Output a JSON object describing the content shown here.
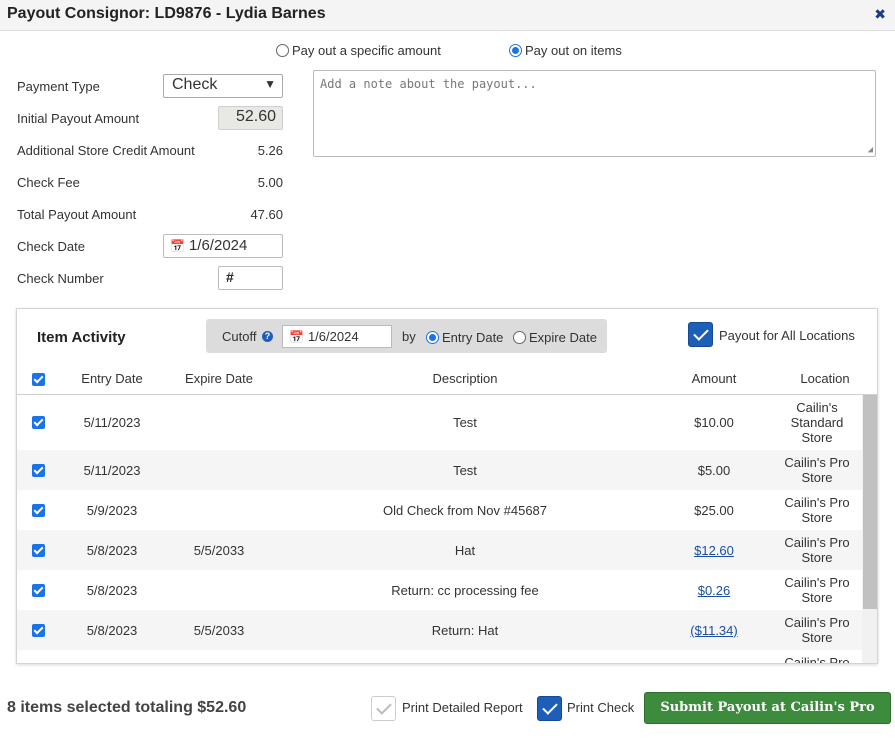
{
  "dialog": {
    "title": "Payout Consignor: LD9876 - Lydia Barnes"
  },
  "payout_mode": {
    "option_amount": "Pay out a specific amount",
    "option_items": "Pay out on items",
    "selected": "Pay out on items"
  },
  "form": {
    "payment_type_label": "Payment Type",
    "payment_type_value": "Check",
    "initial_label": "Initial Payout Amount",
    "initial_value": "52.60",
    "credit_label": "Additional Store Credit Amount",
    "credit_value": "5.26",
    "fee_label": "Check Fee",
    "fee_value": "5.00",
    "total_label": "Total Payout Amount",
    "total_value": "47.60",
    "date_label": "Check Date",
    "date_value": "1/6/2024",
    "number_label": "Check Number",
    "number_placeholder": "#"
  },
  "note": {
    "placeholder": "Add a note about the payout..."
  },
  "activity": {
    "title": "Item Activity",
    "cutoff_label": "Cutoff",
    "cutoff_date": "1/6/2024",
    "by_label": "by",
    "by_entry": "Entry Date",
    "by_expire": "Expire Date",
    "by_selected": "Entry Date",
    "all_locations_label": "Payout for All Locations",
    "all_locations_checked": true,
    "columns": [
      "Entry Date",
      "Expire Date",
      "Description",
      "Amount",
      "Location"
    ],
    "rows": [
      {
        "entry": "5/11/2023",
        "expire": "",
        "desc": "Test",
        "amount": "$10.00",
        "amount_link": false,
        "location": [
          "Cailin's",
          "Standard",
          "Store"
        ]
      },
      {
        "entry": "5/11/2023",
        "expire": "",
        "desc": "Test",
        "amount": "$5.00",
        "amount_link": false,
        "location": [
          "Cailin's Pro",
          "Store"
        ]
      },
      {
        "entry": "5/9/2023",
        "expire": "",
        "desc": "Old Check from Nov #45687",
        "amount": "$25.00",
        "amount_link": false,
        "location": [
          "Cailin's Pro",
          "Store"
        ]
      },
      {
        "entry": "5/8/2023",
        "expire": "5/5/2033",
        "desc": "Hat",
        "amount": "$12.60",
        "amount_link": true,
        "location": [
          "Cailin's Pro",
          "Store"
        ]
      },
      {
        "entry": "5/8/2023",
        "expire": "",
        "desc": "Return: cc processing fee",
        "amount": "$0.26",
        "amount_link": true,
        "location": [
          "Cailin's Pro",
          "Store"
        ]
      },
      {
        "entry": "5/8/2023",
        "expire": "5/5/2033",
        "desc": "Return: Hat",
        "amount": "($11.34)",
        "amount_link": true,
        "location": [
          "Cailin's Pro",
          "Store"
        ]
      },
      {
        "entry": "",
        "expire": "",
        "desc": "",
        "amount": "",
        "amount_link": false,
        "location": [
          "Cailin's Pro"
        ]
      }
    ]
  },
  "footer": {
    "summary": "8 items selected totaling $52.60",
    "print_report_label": "Print Detailed Report",
    "print_report_checked": false,
    "print_check_label": "Print Check",
    "print_check_checked": true,
    "submit_label": "Submit Payout at Cailin's Pro Store"
  },
  "colors": {
    "accent": "#1a73e8",
    "submit": "#3d8b3d",
    "link": "#1a4fa0"
  },
  "icons": [
    "close-icon",
    "calendar-icon",
    "help-icon",
    "chevron-down-icon",
    "checkmark-icon",
    "resize-grip-icon"
  ]
}
